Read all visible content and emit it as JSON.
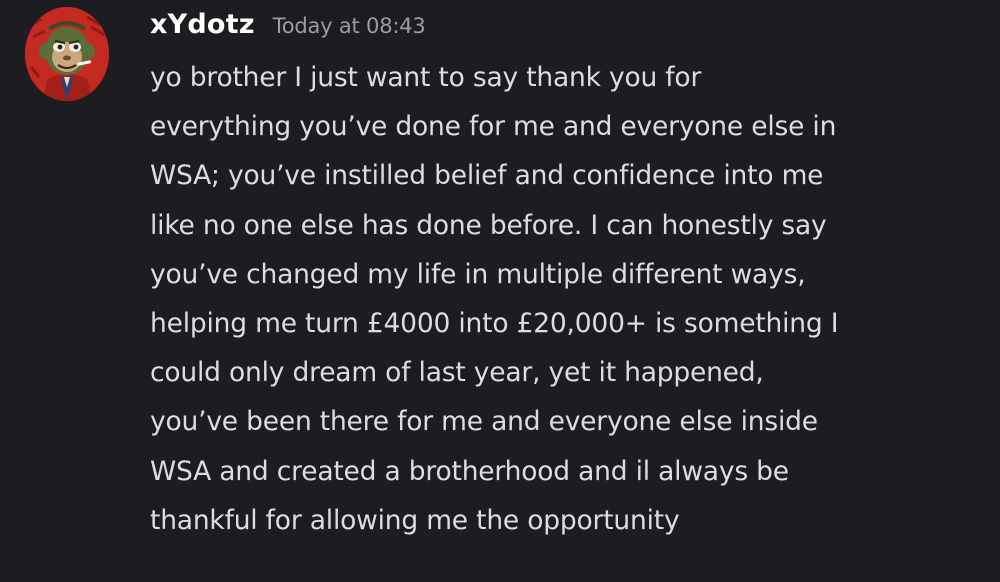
{
  "message": {
    "author": "xYdotz",
    "timestamp": "Today at 08:43",
    "avatar_icon": "ape-avatar-icon",
    "lines": [
      "yo brother I just want to say thank you for",
      "everything you’ve done for me and everyone else in",
      "WSA; you’ve instilled belief and confidence into me",
      "like no one else has done before. I can honestly say",
      "you’ve changed my life in multiple different ways,",
      "helping me turn £4000 into £20,000+ is something I",
      "could only dream of last year, yet it happened,",
      "you’ve been there for me and everyone else inside",
      "WSA and created a brotherhood and il always be",
      "thankful for allowing me the opportunity"
    ]
  },
  "colors": {
    "background": "#1c1c21",
    "username": "#ffffff",
    "timestamp": "#9b9ca2",
    "message_text": "#dcdde0",
    "avatar_background": "#c42a22"
  }
}
